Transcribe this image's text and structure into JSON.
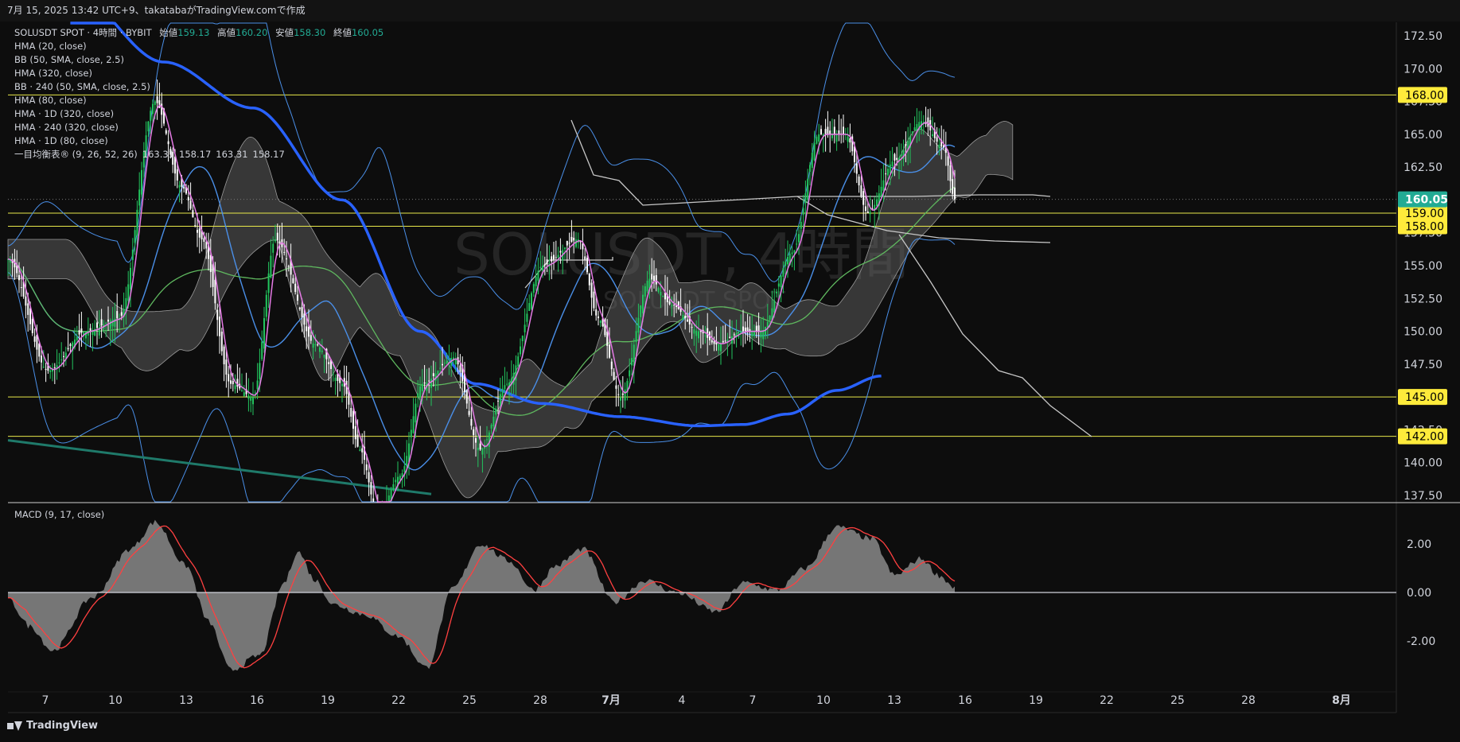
{
  "header": {
    "text": "7月 15, 2025 13:42 UTC+9、takatabaがTradingView.comで作成"
  },
  "legend": {
    "symbol": "SOLUSDT SPOT · 4時間 · BYBIT",
    "open_label": "始値",
    "open": "159.13",
    "high_label": "高値",
    "high": "160.20",
    "low_label": "安値",
    "low": "158.30",
    "close_label": "終値",
    "close": "160.05",
    "indicators": [
      "HMA (20, close)",
      "BB (50, SMA, close, 2.5)",
      "HMA (320, close)",
      "BB · 240 (50, SMA, close, 2.5)",
      "HMA (80, close)",
      "HMA · 1D (320, close)",
      "HMA · 240 (320, close)",
      "HMA · 1D (80, close)"
    ],
    "ichimoku": "一目均衡表® (9, 26, 52, 26)",
    "ichimoku_values": [
      "163.31",
      "158.17",
      "163.31",
      "158.17"
    ]
  },
  "watermark": {
    "title": "SOLUSDT, 4時間",
    "subtitle": "SOLUSDT SPOT"
  },
  "macd_label": "MACD (9, 17, close)",
  "footer": {
    "brand": "TradingView"
  },
  "colors": {
    "up": "#22c55e",
    "down": "#ffffff",
    "hline": "#e8e84a",
    "price_tag": "#ffeb3b",
    "last_tag": "#22ab94",
    "hma_thick": "#2962ff",
    "bb": "#4a8fe8",
    "hma_pink": "#e57ae5",
    "green_ma": "#5fb85f",
    "teal_ma": "#1f7a6a",
    "forecast": "#c8c8c8",
    "macd_hist": "#8a8a8a",
    "macd_signal": "#ff4040"
  },
  "chart_data": {
    "type": "candlestick",
    "price_axis": {
      "ticks": [
        "172.50",
        "170.00",
        "167.50",
        "165.00",
        "162.50",
        "160.00",
        "157.50",
        "155.00",
        "152.50",
        "150.00",
        "147.50",
        "145.00",
        "142.50",
        "140.00",
        "137.50"
      ],
      "ylim": [
        137.5,
        172.5
      ]
    },
    "horizontal_lines": [
      {
        "price": 168.0,
        "label": "168.00"
      },
      {
        "price": 159.0,
        "label": "159.00"
      },
      {
        "price": 158.0,
        "label": "158.00"
      },
      {
        "price": 145.0,
        "label": "145.00"
      },
      {
        "price": 142.0,
        "label": "142.00"
      }
    ],
    "last_price": {
      "price": 160.05,
      "label": "160.05"
    },
    "time_axis": {
      "labels": [
        "7",
        "10",
        "13",
        "16",
        "19",
        "22",
        "25",
        "28",
        "7月",
        "4",
        "7",
        "10",
        "13",
        "16",
        "19",
        "22",
        "25",
        "28",
        "8月"
      ],
      "bold": [
        "7月",
        "8月"
      ]
    },
    "macd_axis": {
      "ticks": [
        "2.00",
        "0.00",
        "-2.00"
      ],
      "ylim": [
        -3.5,
        3.5
      ]
    },
    "price_path_anchors": [
      [
        0,
        155.5
      ],
      [
        18,
        147
      ],
      [
        35,
        150
      ],
      [
        50,
        151
      ],
      [
        66,
        167.5
      ],
      [
        78,
        161
      ],
      [
        87,
        157
      ],
      [
        100,
        146
      ],
      [
        110,
        145
      ],
      [
        120,
        157
      ],
      [
        138,
        149
      ],
      [
        150,
        146
      ],
      [
        158,
        141
      ],
      [
        166,
        136
      ],
      [
        176,
        139
      ],
      [
        186,
        146
      ],
      [
        200,
        148
      ],
      [
        212,
        141
      ],
      [
        224,
        146
      ],
      [
        240,
        155
      ],
      [
        256,
        157
      ],
      [
        265,
        151
      ],
      [
        275,
        145
      ],
      [
        288,
        154
      ],
      [
        298,
        152
      ],
      [
        310,
        150
      ],
      [
        318,
        149
      ],
      [
        330,
        150
      ],
      [
        338,
        150
      ],
      [
        352,
        156
      ],
      [
        364,
        165
      ],
      [
        376,
        165
      ],
      [
        386,
        159
      ],
      [
        398,
        163
      ],
      [
        410,
        166
      ],
      [
        420,
        164
      ],
      [
        425,
        160.05
      ]
    ],
    "macd_anchors": [
      [
        0,
        -0.3
      ],
      [
        10,
        -1.4
      ],
      [
        20,
        -2.4
      ],
      [
        38,
        -0.2
      ],
      [
        55,
        1.8
      ],
      [
        66,
        2.9
      ],
      [
        80,
        1.1
      ],
      [
        90,
        -1.2
      ],
      [
        100,
        -3.2
      ],
      [
        113,
        -2.6
      ],
      [
        124,
        0.4
      ],
      [
        130,
        1.7
      ],
      [
        138,
        0.5
      ],
      [
        146,
        -0.5
      ],
      [
        160,
        -0.9
      ],
      [
        175,
        -1.8
      ],
      [
        188,
        -3.1
      ],
      [
        200,
        0.2
      ],
      [
        212,
        2.0
      ],
      [
        225,
        1.3
      ],
      [
        236,
        0.1
      ],
      [
        246,
        1.1
      ],
      [
        258,
        1.8
      ],
      [
        272,
        -0.4
      ],
      [
        286,
        0.5
      ],
      [
        300,
        0.0
      ],
      [
        318,
        -0.8
      ],
      [
        330,
        0.4
      ],
      [
        345,
        0.1
      ],
      [
        358,
        1.0
      ],
      [
        372,
        2.7
      ],
      [
        388,
        2.2
      ],
      [
        398,
        0.7
      ],
      [
        410,
        1.4
      ],
      [
        418,
        0.7
      ],
      [
        425,
        0.2
      ]
    ]
  }
}
